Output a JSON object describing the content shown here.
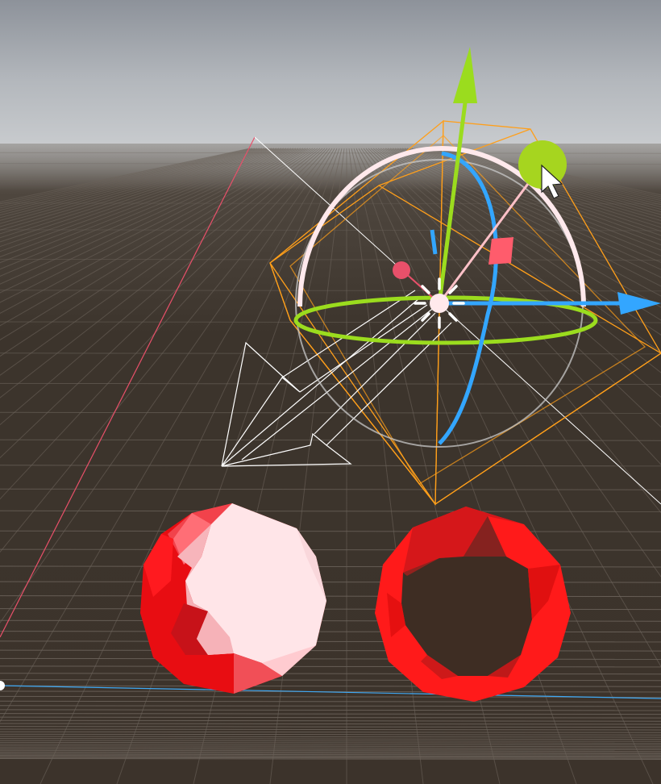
{
  "scene": {
    "sky_color_top": "#8d929a",
    "sky_color_horizon": "#c3c7cb",
    "ground_color": "#3a322a",
    "grid_color": "#6a625a",
    "selection_outline_color": "#ff9f1a"
  },
  "gizmo": {
    "type": "rotate-and-translate",
    "y_axis_color": "#9bdc1e",
    "x_axis_color": "#33a6ff",
    "z_axis_color": "#e8506a",
    "free_rotate_ring_color": "#ffe9ec"
  },
  "light": {
    "type": "directional-light",
    "icon_color": "#ffffff"
  },
  "objects": [
    {
      "name": "solid-red-sphere",
      "color": "#ff1a1a",
      "highlight": "#ffe8ea"
    },
    {
      "name": "transparent-red-sphere",
      "color": "#ff1a1a"
    }
  ],
  "cursor": {
    "icon": "arrow-pointer"
  }
}
